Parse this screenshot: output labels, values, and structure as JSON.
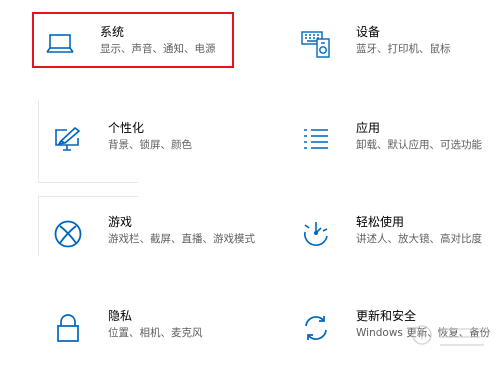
{
  "tiles": {
    "system": {
      "title": "系统",
      "desc": "显示、声音、通知、电源",
      "icon": "laptop-icon"
    },
    "devices": {
      "title": "设备",
      "desc": "蓝牙、打印机、鼠标",
      "icon": "keyboard-device-icon"
    },
    "personalization": {
      "title": "个性化",
      "desc": "背景、锁屏、颜色",
      "icon": "paint-monitor-icon"
    },
    "apps": {
      "title": "应用",
      "desc": "卸载、默认应用、可选功能",
      "icon": "apps-list-icon"
    },
    "gaming": {
      "title": "游戏",
      "desc": "游戏栏、截屏、直播、游戏模式",
      "icon": "xbox-icon"
    },
    "ease": {
      "title": "轻松使用",
      "desc": "讲述人、放大镜、高对比度",
      "icon": "ease-of-access-icon"
    },
    "privacy": {
      "title": "隐私",
      "desc": "位置、相机、麦克风",
      "icon": "lock-icon"
    },
    "update": {
      "title": "更新和安全",
      "desc": "Windows 更新、恢复、备份",
      "icon": "refresh-icon"
    }
  },
  "accent_color": "#0067c0",
  "highlight_color": "#e3141b"
}
